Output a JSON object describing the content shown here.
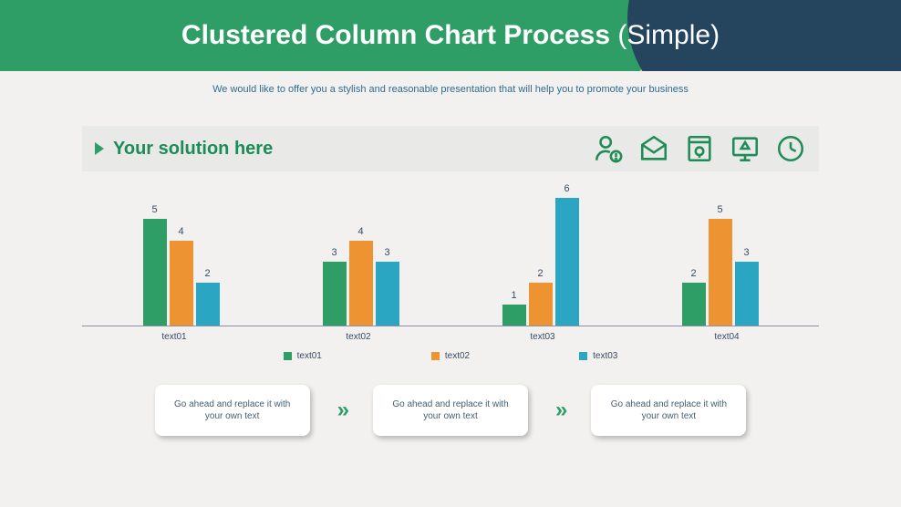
{
  "header": {
    "title_bold": "Clustered Column Chart Process",
    "title_light": " (Simple)"
  },
  "subtitle": "We would like to offer you a stylish and reasonable presentation that will help you to promote your business",
  "solution_bar": {
    "label": "Your solution here"
  },
  "chart_data": {
    "type": "bar",
    "categories": [
      "text01",
      "text02",
      "text03",
      "text04"
    ],
    "series": [
      {
        "name": "text01",
        "color": "#2f9e66",
        "values": [
          5,
          3,
          1,
          2
        ]
      },
      {
        "name": "text02",
        "color": "#ed9332",
        "values": [
          4,
          4,
          2,
          5
        ]
      },
      {
        "name": "text03",
        "color": "#2aa6c2",
        "values": [
          2,
          3,
          6,
          3
        ]
      }
    ],
    "ylim": [
      0,
      6
    ],
    "title": "",
    "xlabel": "",
    "ylabel": ""
  },
  "process": {
    "boxes": [
      "Go ahead and replace it with your own text",
      "Go ahead and replace it with your own text",
      "Go ahead and replace it with your own text"
    ],
    "chevron": "»"
  }
}
